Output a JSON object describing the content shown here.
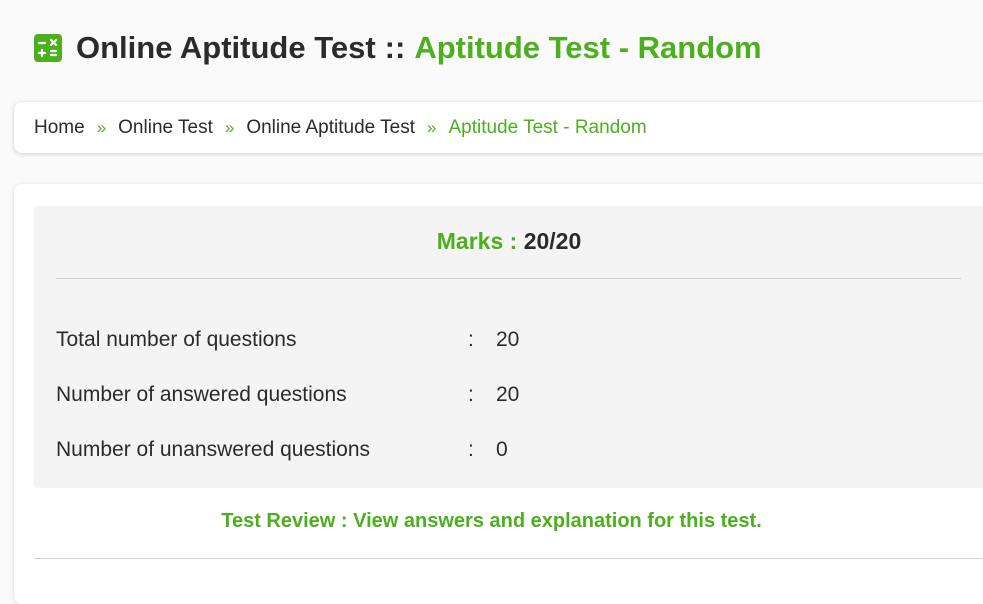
{
  "header": {
    "icon": "calculator-icon",
    "title_main": "Online Aptitude Test",
    "title_separator": "::",
    "title_sub": "Aptitude Test - Random"
  },
  "breadcrumb": {
    "separator": "»",
    "items": [
      {
        "label": "Home"
      },
      {
        "label": "Online Test"
      },
      {
        "label": "Online Aptitude Test"
      },
      {
        "label": "Aptitude Test - Random"
      }
    ]
  },
  "result": {
    "marks_label": "Marks :",
    "marks_value": "20/20",
    "rows": [
      {
        "label": "Total number of questions",
        "colon": ":",
        "value": "20"
      },
      {
        "label": "Number of answered questions",
        "colon": ":",
        "value": "20"
      },
      {
        "label": "Number of unanswered questions",
        "colon": ":",
        "value": "0"
      }
    ]
  },
  "review": {
    "link_text": "Test Review : View answers and explanation for this test."
  },
  "colors": {
    "accent": "#4caf1e",
    "text": "#2b2b2b",
    "panel": "#f4f4f4"
  }
}
